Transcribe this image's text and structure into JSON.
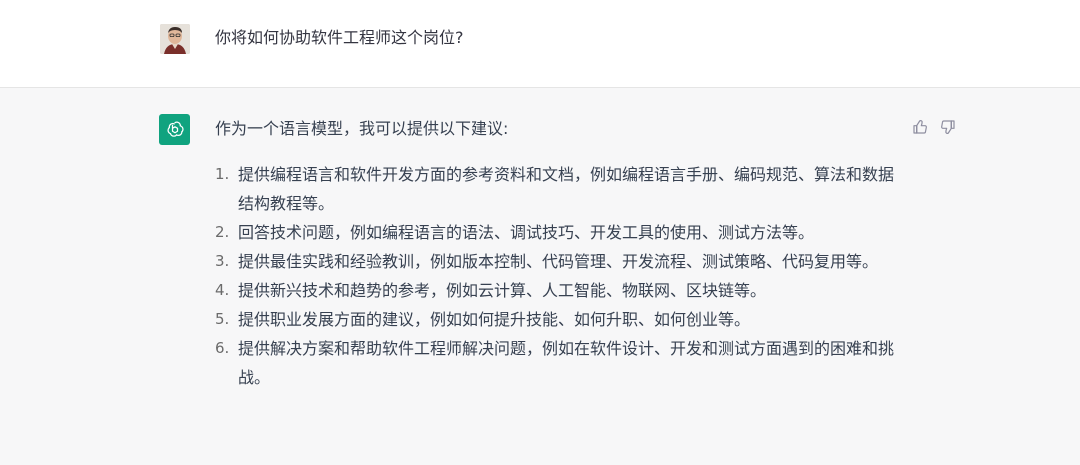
{
  "conversation": {
    "user_message": "你将如何协助软件工程师这个岗位?",
    "assistant_intro": "作为一个语言模型，我可以提供以下建议:",
    "assistant_items": [
      {
        "num": "1.",
        "text": "提供编程语言和软件开发方面的参考资料和文档，例如编程语言手册、编码规范、算法和数据结构教程等。"
      },
      {
        "num": "2.",
        "text": "回答技术问题，例如编程语言的语法、调试技巧、开发工具的使用、测试方法等。"
      },
      {
        "num": "3.",
        "text": "提供最佳实践和经验教训，例如版本控制、代码管理、开发流程、测试策略、代码复用等。"
      },
      {
        "num": "4.",
        "text": "提供新兴技术和趋势的参考，例如云计算、人工智能、物联网、区块链等。"
      },
      {
        "num": "5.",
        "text": "提供职业发展方面的建议，例如如何提升技能、如何升职、如何创业等。"
      },
      {
        "num": "6.",
        "text": "提供解决方案和帮助软件工程师解决问题，例如在软件设计、开发和测试方面遇到的困难和挑战。"
      }
    ]
  },
  "icons": {
    "user_avatar": "user-avatar",
    "assistant_avatar": "openai-logo-icon",
    "like": "thumbs-up-icon",
    "dislike": "thumbs-down-icon"
  },
  "colors": {
    "assistant_bg": "#f7f7f8",
    "user_bg": "#ffffff",
    "brand_green": "#10a37f"
  }
}
